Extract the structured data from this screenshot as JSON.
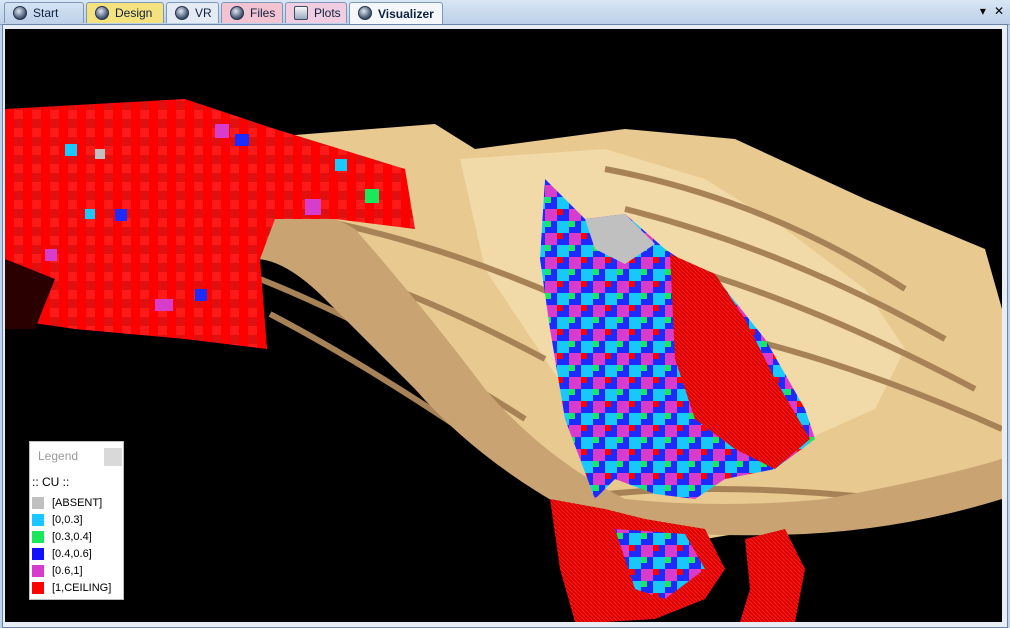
{
  "tabs": [
    {
      "label": "Start",
      "icon": "globe-icon",
      "bg": "#e9f0f8"
    },
    {
      "label": "Design",
      "icon": "globe-icon",
      "bg": "#f4e27e"
    },
    {
      "label": "VR",
      "icon": "vr-globe-icon",
      "bg": "#e5ebf4"
    },
    {
      "label": "Files",
      "icon": "globe-icon",
      "bg": "#f2c3d0"
    },
    {
      "label": "Plots",
      "icon": "chart-window-icon",
      "bg": "#f0cde0"
    },
    {
      "label": "Visualizer",
      "icon": "globe-icon",
      "bg": "#f4f8fc",
      "active": true
    }
  ],
  "controls": {
    "dropdown": "▾",
    "close": "✕"
  },
  "legend": {
    "title": "Legend",
    "variable": ":: CU ::",
    "items": [
      {
        "label": "[ABSENT]",
        "color": "#c0c0c0"
      },
      {
        "label": "[0,0.3]",
        "color": "#19c8ff"
      },
      {
        "label": "[0.3,0.4]",
        "color": "#19e85a"
      },
      {
        "label": "[0.4,0.6]",
        "color": "#1010ff"
      },
      {
        "label": "[0.6,1]",
        "color": "#d83ccc"
      },
      {
        "label": "[1,CEILING]",
        "color": "#ff0000"
      }
    ]
  }
}
